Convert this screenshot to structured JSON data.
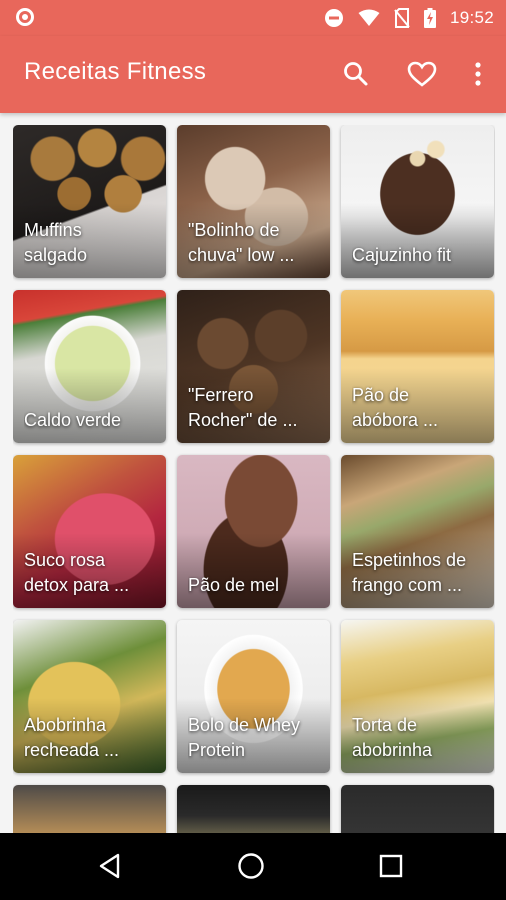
{
  "status_bar": {
    "time": "19:52",
    "icons": [
      "app-notification-icon",
      "do-not-disturb-icon",
      "wifi-icon",
      "no-sim-icon",
      "battery-charging-icon"
    ]
  },
  "app_bar": {
    "title": "Receitas Fitness",
    "actions": [
      "search-icon",
      "favorite-heart-icon",
      "more-vert-icon"
    ],
    "color": "#e8675b"
  },
  "recipes": [
    {
      "label": "Muffins\nsalgado"
    },
    {
      "label": "\"Bolinho de\nchuva\" low ..."
    },
    {
      "label": "Cajuzinho fit"
    },
    {
      "label": "Caldo verde"
    },
    {
      "label": "\"Ferrero\nRocher\" de ..."
    },
    {
      "label": "Pão de\nabóbora ..."
    },
    {
      "label": "Suco rosa\ndetox para ..."
    },
    {
      "label": "Pão de mel"
    },
    {
      "label": "Espetinhos de\nfrango com ..."
    },
    {
      "label": "Abobrinha\nrecheada ..."
    },
    {
      "label": "Bolo de Whey\nProtein"
    },
    {
      "label": "Torta de\nabobrinha"
    },
    {
      "label": ""
    },
    {
      "label": ""
    },
    {
      "label": ""
    }
  ],
  "nav_bar": {
    "buttons": [
      "back-icon",
      "home-icon",
      "recents-icon"
    ]
  }
}
